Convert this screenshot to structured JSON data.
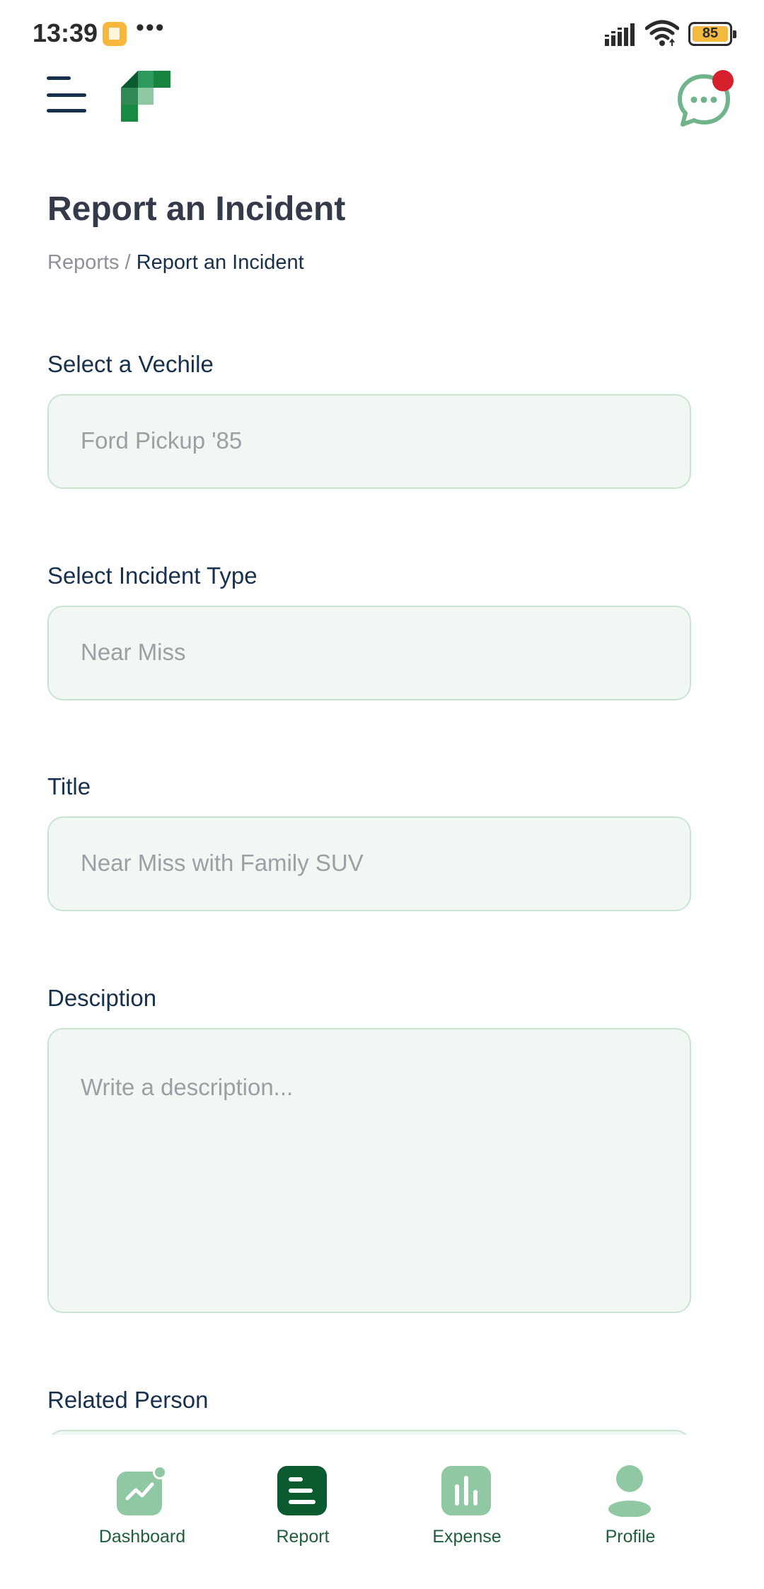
{
  "status_bar": {
    "time": "13:39",
    "more": "•••",
    "battery": "85"
  },
  "header": {
    "menu_icon": "hamburger-menu-icon",
    "logo_icon": "app-logo-icon",
    "chat_icon": "chat-bubble-icon",
    "chat_has_notification": true
  },
  "page": {
    "title": "Report an Incident",
    "breadcrumb": {
      "parent": "Reports",
      "separator": " / ",
      "current": "Report an Incident"
    }
  },
  "form": {
    "vehicle": {
      "label": "Select a Vechile",
      "value": "Ford Pickup '85"
    },
    "incident_type": {
      "label": "Select Incident Type",
      "value": "Near Miss"
    },
    "title": {
      "label": "Title",
      "value": "Near Miss with Family SUV"
    },
    "description": {
      "label": "Desciption",
      "placeholder": "Write a description..."
    },
    "related_person": {
      "label": "Related Person"
    }
  },
  "bottom_nav": {
    "items": [
      {
        "label": "Dashboard",
        "icon": "dashboard-chart-icon",
        "active": false
      },
      {
        "label": "Report",
        "icon": "report-list-icon",
        "active": true
      },
      {
        "label": "Expense",
        "icon": "expense-bars-icon",
        "active": false
      },
      {
        "label": "Profile",
        "icon": "profile-person-icon",
        "active": false
      }
    ]
  },
  "colors": {
    "brand_dark": "#0b5a30",
    "brand_light": "#8fc8a3",
    "field_bg": "#f1f7f3",
    "field_border": "#c9e4d3",
    "notification": "#d61f2c",
    "text_primary": "#17304d"
  }
}
